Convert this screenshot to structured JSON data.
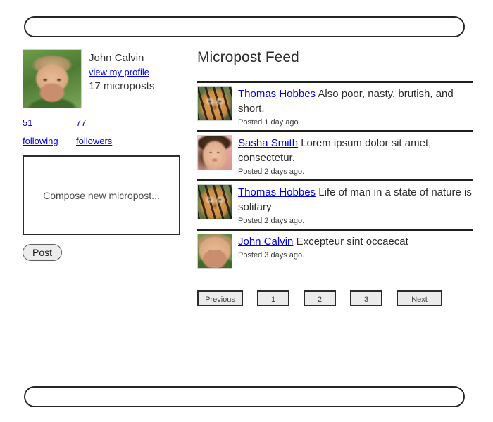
{
  "header": {
    "bar_label": ""
  },
  "footer": {
    "bar_label": ""
  },
  "sidebar": {
    "user": {
      "name": "John Calvin",
      "profile_link": "view my profile",
      "micropost_count": "17 microposts",
      "avatar": "child-avatar"
    },
    "stats": [
      {
        "value": "51",
        "label": "following"
      },
      {
        "value": "77",
        "label": "followers"
      }
    ],
    "compose": {
      "placeholder": "Compose new micropost...",
      "value": "",
      "post_label": "Post"
    }
  },
  "feed": {
    "title": "Micropost Feed",
    "posts": [
      {
        "author": "Thomas Hobbes",
        "text": "Also poor, nasty, brutish, and short.",
        "time": "Posted 1 day ago.",
        "avatar": "tiger-avatar"
      },
      {
        "author": "Sasha Smith",
        "text": "Lorem ipsum dolor sit amet, consectetur.",
        "time": "Posted 2 days ago.",
        "avatar": "woman-avatar"
      },
      {
        "author": "Thomas Hobbes",
        "text": "Life of man in a state of nature is solitary",
        "time": "Posted 2 days ago.",
        "avatar": "tiger-avatar"
      },
      {
        "author": "John Calvin",
        "text": "Excepteur sint occaecat",
        "time": "Posted 3 days ago.",
        "avatar": "child-avatar"
      }
    ],
    "pagination": [
      {
        "label": "Previous",
        "kind": "wide"
      },
      {
        "label": "1",
        "kind": "num"
      },
      {
        "label": "2",
        "kind": "num"
      },
      {
        "label": "3",
        "kind": "num"
      },
      {
        "label": "Next",
        "kind": "wide"
      }
    ]
  },
  "colors": {
    "link": "#0000ee",
    "text": "#2b2b2b",
    "rule": "#1e1e1e",
    "button_face": "#ebebeb"
  }
}
